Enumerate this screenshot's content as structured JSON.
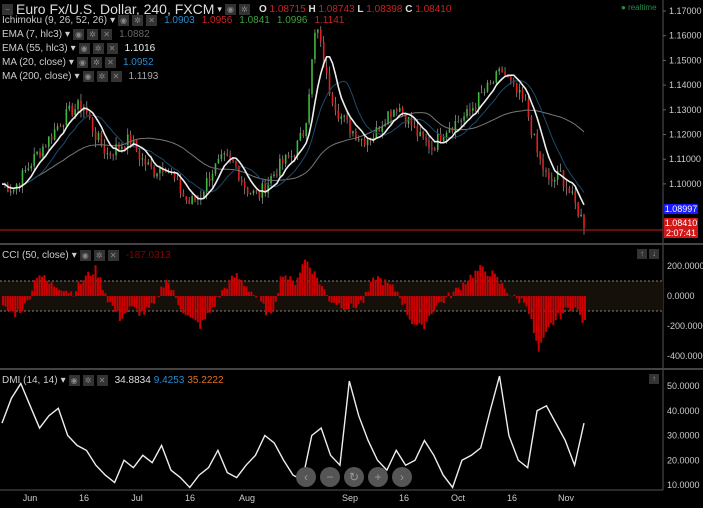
{
  "header": {
    "title": "Euro Fx/U.S. Dollar, 240, FXCM",
    "o_label": "O",
    "o": "1.08715",
    "h_label": "H",
    "h": "1.08743",
    "l_label": "L",
    "l": "1.08398",
    "c_label": "C",
    "c": "1.08410",
    "status": "realtime"
  },
  "indicators": [
    {
      "name": "Ichimoku (9, 26, 52, 26)",
      "values": [
        "1.0903",
        "1.0956",
        "1.0841",
        "1.0996",
        "1.1141"
      ]
    },
    {
      "name": "EMA (7, hlc3)",
      "values": [
        "1.0882"
      ]
    },
    {
      "name": "EMA (55, hlc3)",
      "values": [
        "1.1016"
      ]
    },
    {
      "name": "MA (20, close)",
      "values": [
        "1.0952"
      ]
    },
    {
      "name": "MA (200, close)",
      "values": [
        "1.1193"
      ]
    }
  ],
  "cci": {
    "name": "CCI (50, close)",
    "value": "-187.0313"
  },
  "dmi": {
    "name": "DMI (14, 14)",
    "values": [
      "34.8834",
      "9.4253",
      "35.2222"
    ]
  },
  "price_labels": {
    "blue": "1.08997",
    "last": "1.08410",
    "timer": "2:07:41"
  },
  "nav": [
    "‹",
    "−",
    "↻",
    "+",
    "›"
  ],
  "colors": {
    "up": "#3fb83f",
    "down": "#e02020",
    "cci": "#cc0000",
    "accent_blue": "#1a1aff"
  },
  "chart_data": [
    {
      "type": "line",
      "title": "Euro Fx/U.S. Dollar, 240, FXCM",
      "ylim": [
        1.08,
        1.17
      ],
      "yticks": [
        "1.17000",
        "1.16000",
        "1.15000",
        "1.14000",
        "1.13000",
        "1.12000",
        "1.11000",
        "1.10000"
      ],
      "xticks": [
        "Jun",
        "16",
        "Jul",
        "16",
        "Aug",
        "Sep",
        "16",
        "Oct",
        "16",
        "Nov"
      ],
      "close": [
        1.1,
        1.098,
        1.105,
        1.112,
        1.118,
        1.125,
        1.13,
        1.132,
        1.12,
        1.112,
        1.115,
        1.118,
        1.11,
        1.105,
        1.108,
        1.1,
        1.092,
        1.095,
        1.105,
        1.11,
        1.108,
        1.098,
        1.095,
        1.102,
        1.108,
        1.112,
        1.122,
        1.165,
        1.14,
        1.128,
        1.122,
        1.118,
        1.12,
        1.128,
        1.132,
        1.125,
        1.118,
        1.115,
        1.122,
        1.125,
        1.128,
        1.135,
        1.14,
        1.146,
        1.138,
        1.132,
        1.112,
        1.1,
        1.104,
        1.094,
        1.084
      ]
    },
    {
      "type": "bar",
      "title": "CCI (50, close)",
      "ylim": [
        -450,
        280
      ],
      "yticks": [
        "200.0000",
        "0.0000",
        "-200.0000",
        "-400.0000"
      ],
      "values": [
        -80,
        -120,
        -60,
        160,
        80,
        60,
        20,
        120,
        180,
        -20,
        -150,
        -80,
        -120,
        -60,
        120,
        -40,
        -150,
        -200,
        -80,
        50,
        140,
        60,
        -30,
        -150,
        160,
        80,
        250,
        120,
        -20,
        -60,
        -80,
        -30,
        130,
        80,
        20,
        -160,
        -220,
        -80,
        -20,
        40,
        120,
        180,
        150,
        60,
        -20,
        -40,
        -380,
        -200,
        -120,
        -60,
        -187
      ]
    },
    {
      "type": "line",
      "title": "DMI (14, 14)",
      "ylim": [
        5,
        56
      ],
      "yticks": [
        "50.0000",
        "40.0000",
        "30.0000",
        "20.0000",
        "10.0000"
      ],
      "values": [
        35,
        45,
        51,
        42,
        33,
        38,
        41,
        30,
        26,
        24,
        18,
        14,
        11,
        20,
        17,
        22,
        19,
        26,
        16,
        13,
        9,
        14,
        17,
        24,
        15,
        13,
        18,
        22,
        30,
        27,
        20,
        14,
        12,
        30,
        33,
        22,
        18,
        52,
        38,
        28,
        20,
        16,
        24,
        18,
        20,
        28,
        22,
        14,
        9,
        20,
        22,
        25,
        40,
        54,
        30,
        20,
        17,
        40,
        42,
        35,
        28,
        18,
        35
      ]
    }
  ]
}
